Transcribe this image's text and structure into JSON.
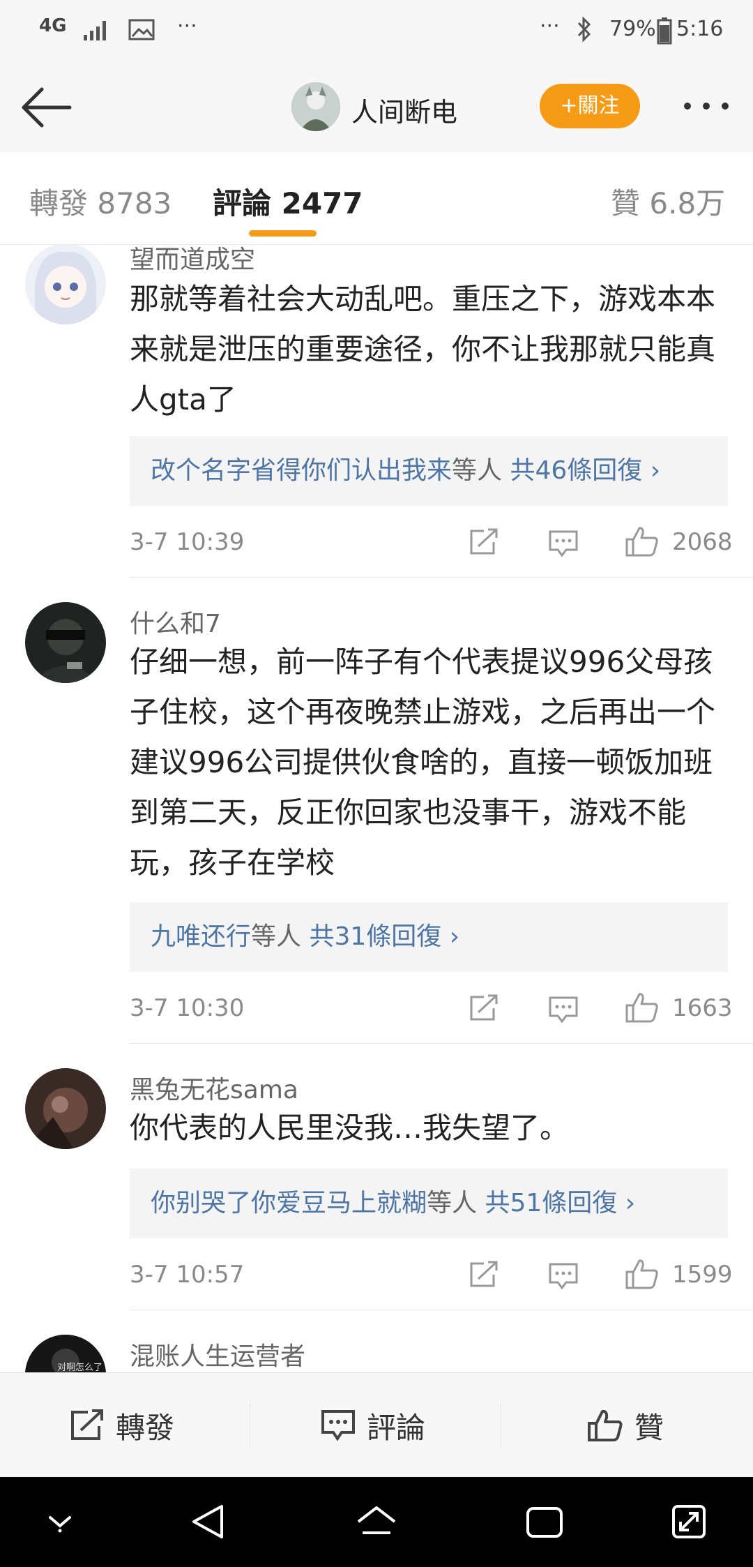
{
  "status_bar": {
    "network": "4G",
    "battery_percent": "79%",
    "time": "5:16"
  },
  "header": {
    "title": "人间断电",
    "follow_label": "+關注",
    "icons": [
      "back-arrow-icon",
      "more-icon"
    ]
  },
  "tabs": {
    "repost": {
      "label": "轉發",
      "count": "8783"
    },
    "comment": {
      "label": "評論",
      "count": "2477"
    },
    "like": {
      "label": "贊",
      "count": "6.8万"
    }
  },
  "comments": [
    {
      "user": "望而道成空",
      "text": "那就等着社会大动乱吧。重压之下，游戏本本来就是泄压的重要途径，你不让我那就只能真人gta了",
      "replies": {
        "names": "改个名字省得你们认出我来",
        "suffix": "等人",
        "count_text": "共46條回復 ›"
      },
      "time": "3-7 10:39",
      "likes": "2068"
    },
    {
      "user": "什么和7",
      "text": "仔细一想，前一阵子有个代表提议996父母孩子住校，这个再夜晚禁止游戏，之后再出一个建议996公司提供伙食啥的，直接一顿饭加班到第二天，反正你回家也没事干，游戏不能玩，孩子在学校",
      "replies": {
        "names": "九唯还行",
        "suffix": "等人",
        "count_text": "共31條回復 ›"
      },
      "time": "3-7 10:30",
      "likes": "1663"
    },
    {
      "user": "黑兔无花sama",
      "text": "你代表的人民里没我…我失望了。",
      "replies": {
        "names": "你别哭了你爱豆马上就糊",
        "suffix": "等人",
        "count_text": "共51條回復 ›"
      },
      "time": "3-7 10:57",
      "likes": "1599"
    },
    {
      "user": "混账人生运营者",
      "avatar_caption": "对啊怎么了"
    }
  ],
  "action_bar": {
    "repost": "轉發",
    "comment": "評論",
    "like": "贊"
  },
  "colors": {
    "accent": "#f59b16",
    "link_blue": "#4d76a6",
    "reply_bg": "#f4f4f4"
  }
}
